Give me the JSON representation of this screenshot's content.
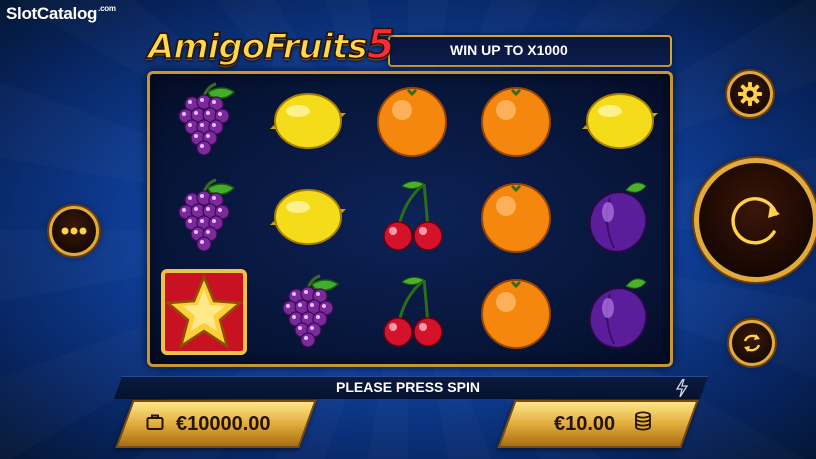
{
  "watermark": {
    "text": "SlotCatalog",
    "suffix": ".com"
  },
  "game": {
    "title_main": "AmigoFruits",
    "title_number": "5",
    "win_text": "WIN UP TO X1000"
  },
  "reels": {
    "columns": 5,
    "rows": 3,
    "symbols": [
      [
        "grapes",
        "lemon",
        "orange",
        "orange",
        "lemon"
      ],
      [
        "grapes",
        "lemon",
        "cherry",
        "orange",
        "plum"
      ],
      [
        "star",
        "grapes",
        "cherry",
        "orange",
        "plum"
      ]
    ]
  },
  "controls": {
    "menu_icon": "more-dots-icon",
    "settings_icon": "gear-icon",
    "spin_icon": "spin-arrow-icon",
    "autoplay_icon": "autoplay-icon"
  },
  "status": {
    "message": "PLEASE PRESS SPIN",
    "icon": "bolt-icon"
  },
  "balance": {
    "value": "€10000.00",
    "icon": "wallet-icon"
  },
  "bet": {
    "value": "€10.00",
    "icon": "coins-icon"
  },
  "colors": {
    "gold": "#e2a93b",
    "background": "#0f3f9a",
    "reel_bg": "#061436"
  }
}
